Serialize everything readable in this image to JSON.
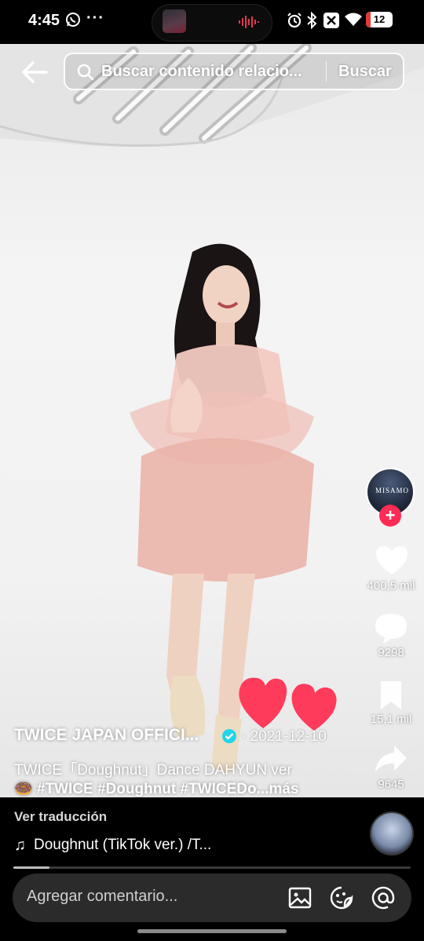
{
  "status_bar": {
    "time": "4:45",
    "battery": "12",
    "battery_fraction": 0.12
  },
  "search": {
    "placeholder": "Buscar contenido relacio...",
    "button_label": "Buscar"
  },
  "icons": {
    "back": "arrow-left-icon",
    "search": "search-icon",
    "like": "heart-icon",
    "comment": "chat-bubble-icon",
    "save": "bookmark-icon",
    "share": "share-arrow-icon",
    "image": "image-icon",
    "sticker": "sticker-icon",
    "mention": "at-icon",
    "music": "music-note-icon"
  },
  "creator": {
    "avatar_text": "MISAMO",
    "follow_label": "+"
  },
  "actions": {
    "likes": "400,5 mil",
    "comments": "9298",
    "saves": "15,1 mil",
    "shares": "9645"
  },
  "post": {
    "author": "TWICE JAPAN OFFICI...",
    "date": "· 2021-12-10",
    "caption_line1": "TWICE「Doughnut」Dance DAHYUN ver",
    "caption_line2": "🍩 #TWICE #Doughnut #TWICEDo...más"
  },
  "bottom": {
    "translate_label": "Ver traducción",
    "music_note": "♫",
    "music_title": "Doughnut (TikTok ver.) /T...",
    "progress_fraction": 0.09,
    "comment_placeholder": "Agregar comentario..."
  },
  "colors": {
    "accent": "#fe2c55",
    "verified": "#20d5ec",
    "heart": "#ff3b5c"
  }
}
